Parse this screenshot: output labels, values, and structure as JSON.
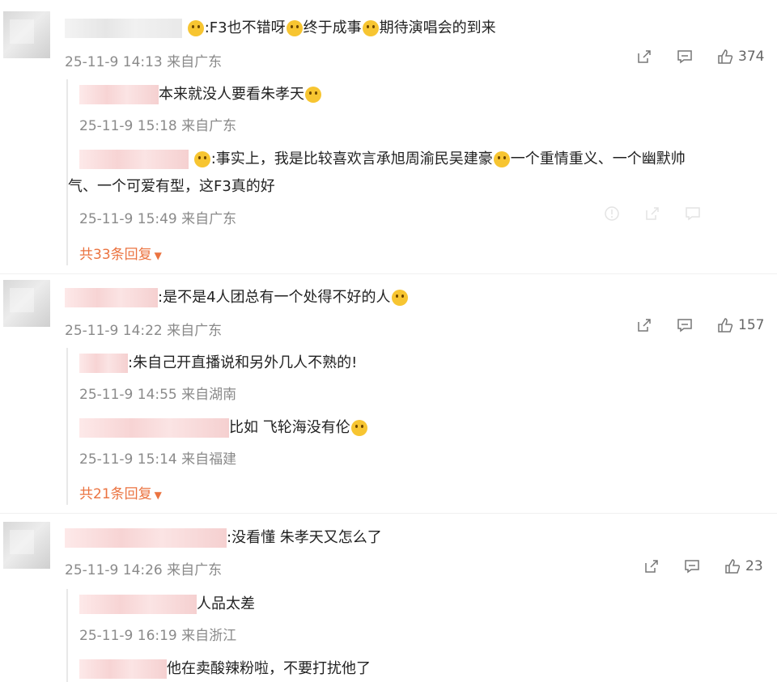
{
  "colors": {
    "accent": "#eb7340",
    "meta": "#8a8a8a",
    "text": "#222222"
  },
  "comments": [
    {
      "text_parts": [
        ":F3也不错呀",
        "终于成事",
        "期待演唱会的到来"
      ],
      "meta": "25-11-9 14:13 来自广东",
      "likes": "374",
      "replies": [
        {
          "text": "本来就没人要看朱孝天",
          "meta": "25-11-9 15:18 来自广东"
        },
        {
          "text_a": ":事实上，我是比较喜欢言承旭周渝民吴建豪",
          "text_b": "一个重情重义、一个幽默帅",
          "text_c": "气、一个可爱有型，这F3真的好",
          "meta": "25-11-9 15:49 来自广东"
        }
      ],
      "more": "共33条回复"
    },
    {
      "text": ":是不是4人团总有一个处得不好的人",
      "meta": "25-11-9 14:22 来自广东",
      "likes": "157",
      "replies": [
        {
          "text": ":朱自己开直播说和另外几人不熟的!",
          "meta": "25-11-9 14:55 来自湖南"
        },
        {
          "text": "比如 飞轮海没有伦",
          "meta": "25-11-9 15:14 来自福建"
        }
      ],
      "more": "共21条回复"
    },
    {
      "text": ":没看懂 朱孝天又怎么了",
      "meta": "25-11-9 14:26 来自广东",
      "likes": "23",
      "replies": [
        {
          "text": "人品太差",
          "meta": "25-11-9 16:19 来自浙江"
        },
        {
          "text": "他在卖酸辣粉啦，不要打扰他了"
        }
      ]
    }
  ],
  "icons": {
    "share": "share-icon",
    "comment": "comment-icon",
    "like": "thumbs-up-icon"
  }
}
